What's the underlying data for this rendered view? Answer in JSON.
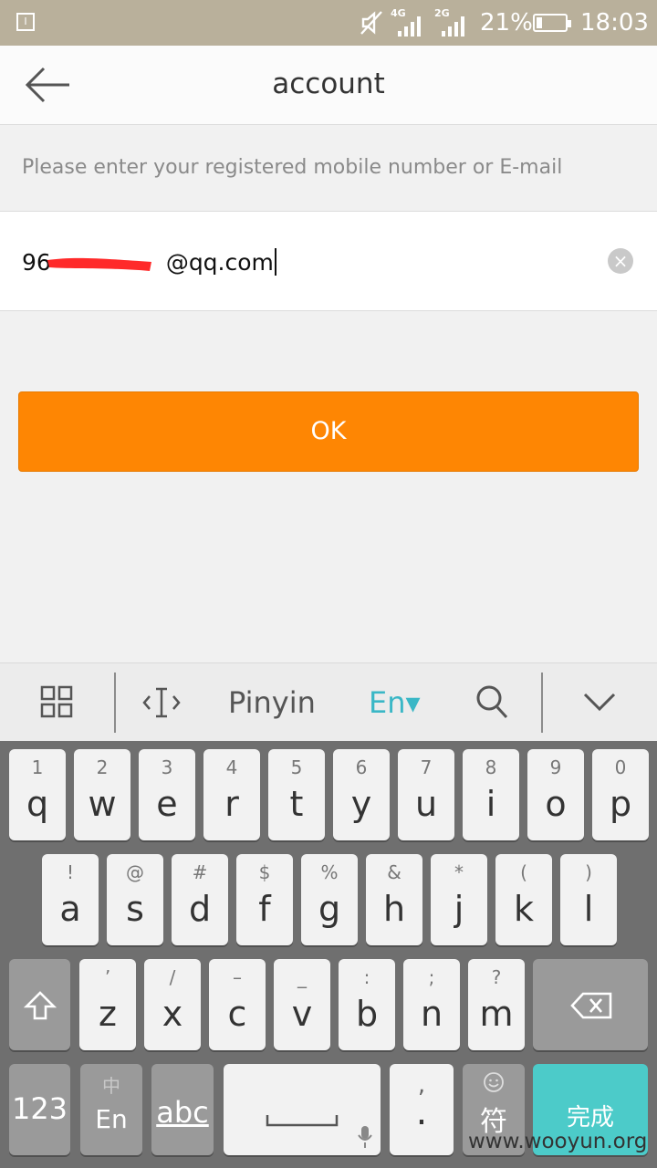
{
  "status": {
    "sim_label": "I",
    "net1": "4G",
    "net2": "2G",
    "battery_pct": "21%",
    "battery_level": 0.21,
    "time": "18:03"
  },
  "appbar": {
    "title": "account",
    "back_icon": "arrow-left-icon"
  },
  "form": {
    "hint": "Please enter your registered mobile number or E-mail",
    "value_prefix": "96",
    "value_suffix": "@qq.com",
    "clear_icon": "close-circle-icon",
    "ok_label": "OK"
  },
  "ime": {
    "grid_icon": "grid-icon",
    "cursor_icon": "text-cursor-icon",
    "pinyin": "Pinyin",
    "en": "En▾",
    "search_icon": "search-icon",
    "collapse_icon": "chevron-down-icon"
  },
  "keyboard": {
    "row1": [
      {
        "sub": "1",
        "key": "q"
      },
      {
        "sub": "2",
        "key": "w"
      },
      {
        "sub": "3",
        "key": "e"
      },
      {
        "sub": "4",
        "key": "r"
      },
      {
        "sub": "5",
        "key": "t"
      },
      {
        "sub": "6",
        "key": "y"
      },
      {
        "sub": "7",
        "key": "u"
      },
      {
        "sub": "8",
        "key": "i"
      },
      {
        "sub": "9",
        "key": "o"
      },
      {
        "sub": "0",
        "key": "p"
      }
    ],
    "row2": [
      {
        "sub": "!",
        "key": "a"
      },
      {
        "sub": "@",
        "key": "s"
      },
      {
        "sub": "#",
        "key": "d"
      },
      {
        "sub": "$",
        "key": "f"
      },
      {
        "sub": "%",
        "key": "g"
      },
      {
        "sub": "&",
        "key": "h"
      },
      {
        "sub": "*",
        "key": "j"
      },
      {
        "sub": "(",
        "key": "k"
      },
      {
        "sub": ")",
        "key": "l"
      }
    ],
    "row3": [
      {
        "sub": "’",
        "key": "z"
      },
      {
        "sub": "/",
        "key": "x"
      },
      {
        "sub": "–",
        "key": "c"
      },
      {
        "sub": "_",
        "key": "v"
      },
      {
        "sub": ":",
        "key": "b"
      },
      {
        "sub": ";",
        "key": "n"
      },
      {
        "sub": "?",
        "key": "m"
      }
    ],
    "shift_icon": "shift-icon",
    "backspace_icon": "backspace-icon",
    "num_label": "123",
    "lang_sub": "中",
    "lang_label": "En",
    "abc_label": "abc",
    "space_icon": "space-icon",
    "mic_icon": "mic-icon",
    "comma_sub": ",",
    "period_label": ".",
    "emoji_icon": "emoji-icon",
    "symbol_label": "符",
    "done_label": "完成"
  },
  "watermark": "www.wooyun.org"
}
